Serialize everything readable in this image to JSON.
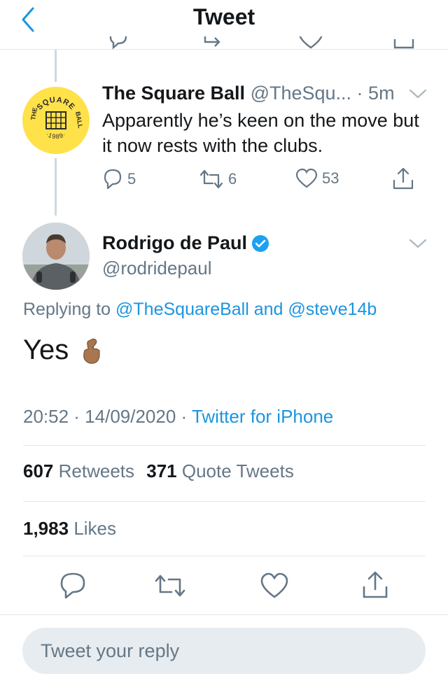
{
  "header": {
    "title": "Tweet"
  },
  "parent_tweet": {
    "author_name": "The Square Ball",
    "handle_time": "@TheSqu... · 5m",
    "text": "Apparently he’s keen on the move but it now rests with the clubs.",
    "logo": {
      "top_text": "SQUARE",
      "left_text": "THE",
      "right_text": "BALL",
      "bottom_text": "·1989·"
    },
    "actions": {
      "replies": "5",
      "retweets": "6",
      "likes": "53"
    }
  },
  "main_tweet": {
    "author_name": "Rodrigo de Paul",
    "handle": "@rodridepaul",
    "replying_prefix": "Replying to",
    "reply_to_1": "@TheSquareBall",
    "reply_and": "and",
    "reply_to_2": "@steve14b",
    "text": "Yes",
    "emoji": "🤞",
    "timestamp": "20:52 · 14/09/2020 ·",
    "source": "Twitter for iPhone",
    "stats": {
      "retweets_count": "607",
      "retweets_label": "Retweets",
      "quotes_count": "371",
      "quotes_label": "Quote Tweets",
      "likes_count": "1,983",
      "likes_label": "Likes"
    }
  },
  "reply_box": {
    "placeholder": "Tweet your reply"
  },
  "colors": {
    "accent": "#1b95e0",
    "muted": "#657786",
    "verified": "#1da1f2",
    "logo_yellow": "#ffe14a"
  },
  "icons": [
    "back-chevron-icon",
    "reply-icon",
    "retweet-icon",
    "like-icon",
    "share-icon",
    "chevron-down-icon",
    "verified-badge-icon"
  ]
}
